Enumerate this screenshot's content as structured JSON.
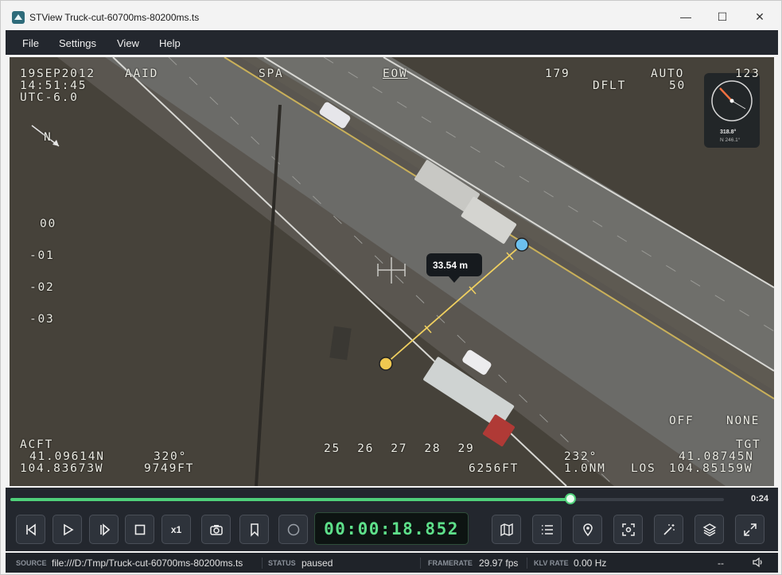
{
  "window": {
    "title": "STView  Truck-cut-60700ms-80200ms.ts",
    "minimize": "—",
    "maximize": "☐",
    "close": "✕"
  },
  "menu": [
    "File",
    "Settings",
    "View",
    "Help"
  ],
  "overlay": {
    "date": "19SEP2012",
    "time": "14:51:45",
    "utc": "UTC-6.0",
    "aaid": "AAID",
    "spa": "SPA",
    "eow": "EOW",
    "heading": "179",
    "auto": "AUTO",
    "auto_val": "123",
    "dflt": "DFLT",
    "dflt_val": "50",
    "north": "N",
    "pitch_ladder": [
      "00",
      "-01",
      "-02",
      "-03"
    ],
    "off": "OFF",
    "none": "NONE",
    "acft_label": "ACFT",
    "acft_lat": "41.09614N",
    "acft_lon": "104.83673W",
    "acft_heading": "320°",
    "acft_alt": "9749FT",
    "scale_ticks": "25  26  27  28  29",
    "slant_alt": "6256FT",
    "range_angle": "232°",
    "range": "1.0NM",
    "los": "LOS",
    "tgt_label": "TGT",
    "tgt_lat": "41.08745N",
    "tgt_lon": "104.85159W",
    "measurement": "33.54 m",
    "compass_bearing": "318.8°",
    "compass_sub": "N 246.1°"
  },
  "controls": {
    "progress": 0.785,
    "duration": "0:24",
    "timecode": "00:00:18.852",
    "speed_label": "x1",
    "accent_color": "#4fd07a"
  },
  "status": {
    "source_key": "SOURCE",
    "source_val": "file:///D:/Tmp/Truck-cut-60700ms-80200ms.ts",
    "status_key": "STATUS",
    "status_val": "paused",
    "framerate_key": "FRAMERATE",
    "framerate_val": "29.97 fps",
    "klv_key": "KLV RATE",
    "klv_val": "0.00 Hz",
    "extra": "--"
  }
}
